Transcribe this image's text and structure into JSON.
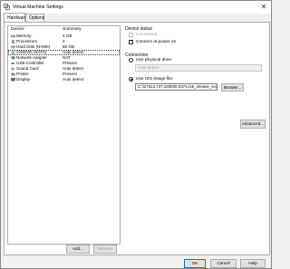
{
  "window": {
    "title": "Virtual Machine Settings",
    "close_symbol": "✕"
  },
  "tabs": [
    {
      "label": "Hardware",
      "active": true
    },
    {
      "label": "Options",
      "active": false
    }
  ],
  "device_list": {
    "headers": {
      "device": "Device",
      "summary": "Summary"
    },
    "rows": [
      {
        "name": "Memory",
        "summary": "4 GB",
        "icon": "memory-icon"
      },
      {
        "name": "Processors",
        "summary": "2",
        "icon": "processor-icon"
      },
      {
        "name": "Hard Disk (NVMe)",
        "summary": "60 GB",
        "icon": "hard-disk-icon"
      },
      {
        "name": "CD/DVD (SATA)",
        "summary": "Auto detect",
        "icon": "cd-dvd-icon",
        "selected": true
      },
      {
        "name": "Network Adapter",
        "summary": "NAT",
        "icon": "network-adapter-icon"
      },
      {
        "name": "USB Controller",
        "summary": "Present",
        "icon": "usb-icon"
      },
      {
        "name": "Sound Card",
        "summary": "Auto detect",
        "icon": "sound-card-icon"
      },
      {
        "name": "Printer",
        "summary": "Present",
        "icon": "printer-icon"
      },
      {
        "name": "Display",
        "summary": "Auto detect",
        "icon": "display-icon"
      }
    ],
    "add_label": "Add...",
    "remove_label": "Remove"
  },
  "device_status": {
    "title": "Device status",
    "connected_label": "Connected",
    "connected_checked": false,
    "poweron_label": "Connect at power on",
    "poweron_checked": true
  },
  "connection": {
    "title": "Connection",
    "physical_label": "Use physical drive:",
    "physical_value": "Auto detect",
    "iso_label": "Use ISO image file:",
    "iso_value": "C:\\\\27613.737.160930-2374.rs5_release_svc_refresh",
    "browse_label": "Browse...",
    "advanced_label": "Advanced...",
    "selected": "iso"
  },
  "footer": {
    "ok_label": "OK",
    "cancel_label": "Cancel",
    "help_label": "Help"
  },
  "colors": {
    "accent": "#0078d7",
    "disabled_text": "#a0a0a0"
  }
}
